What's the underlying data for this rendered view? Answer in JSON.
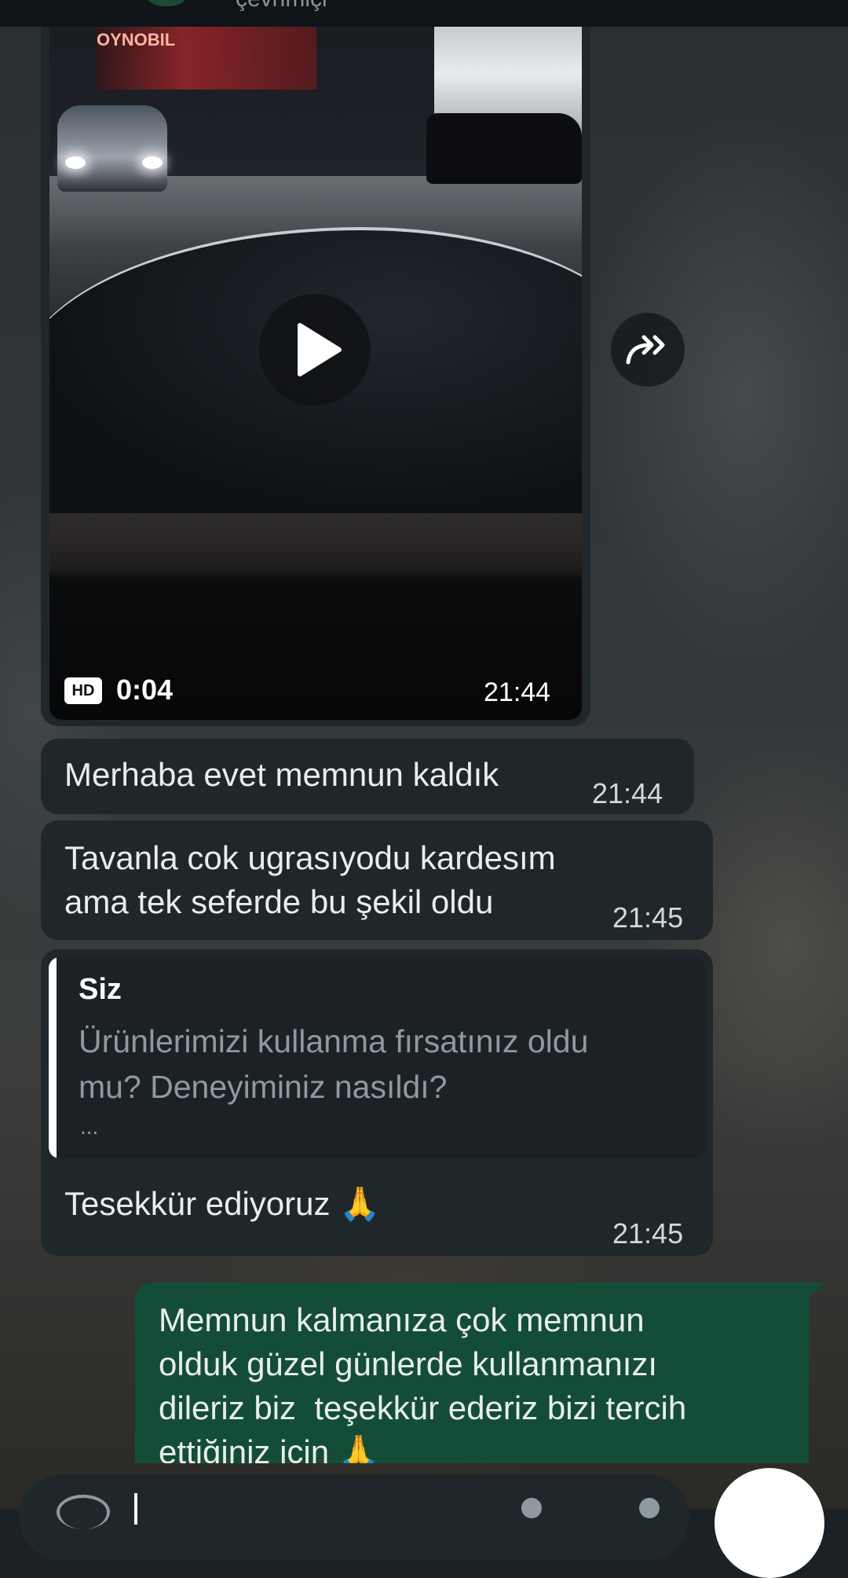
{
  "header": {
    "status_text": "çevrimiçi"
  },
  "video_message": {
    "sign_text": "OYNOBIL",
    "hd_label": "HD",
    "duration": "0:04",
    "time": "21:44"
  },
  "messages": [
    {
      "text": "Merhaba evet memnun kaldık",
      "time": "21:44"
    },
    {
      "text": "Tavanla cok ugrasıyodu kardesım\nama tek seferde bu şekil oldu",
      "time": "21:45"
    },
    {
      "reply_author": "Siz",
      "reply_quote": "Ürünlerimizi kullanma fırsatınız oldu\nmu? Deneyiminiz nasıldı?",
      "reply_ellipsis": "...",
      "text": "Tesekkür ediyoruz 🙏",
      "time": "21:45"
    }
  ],
  "outgoing_message": {
    "text": "Memnun kalmanıza çok memnun\nolduk güzel günlerde kullanmanızı\ndileriz biz  teşekkür ederiz bizi tercih\nettiğiniz için 🙏"
  },
  "icons": {
    "play": "play-icon",
    "forward": "forward-icon",
    "emoji": "emoji-icon",
    "attach": "attach-icon",
    "camera": "camera-icon",
    "mic": "mic-icon"
  }
}
